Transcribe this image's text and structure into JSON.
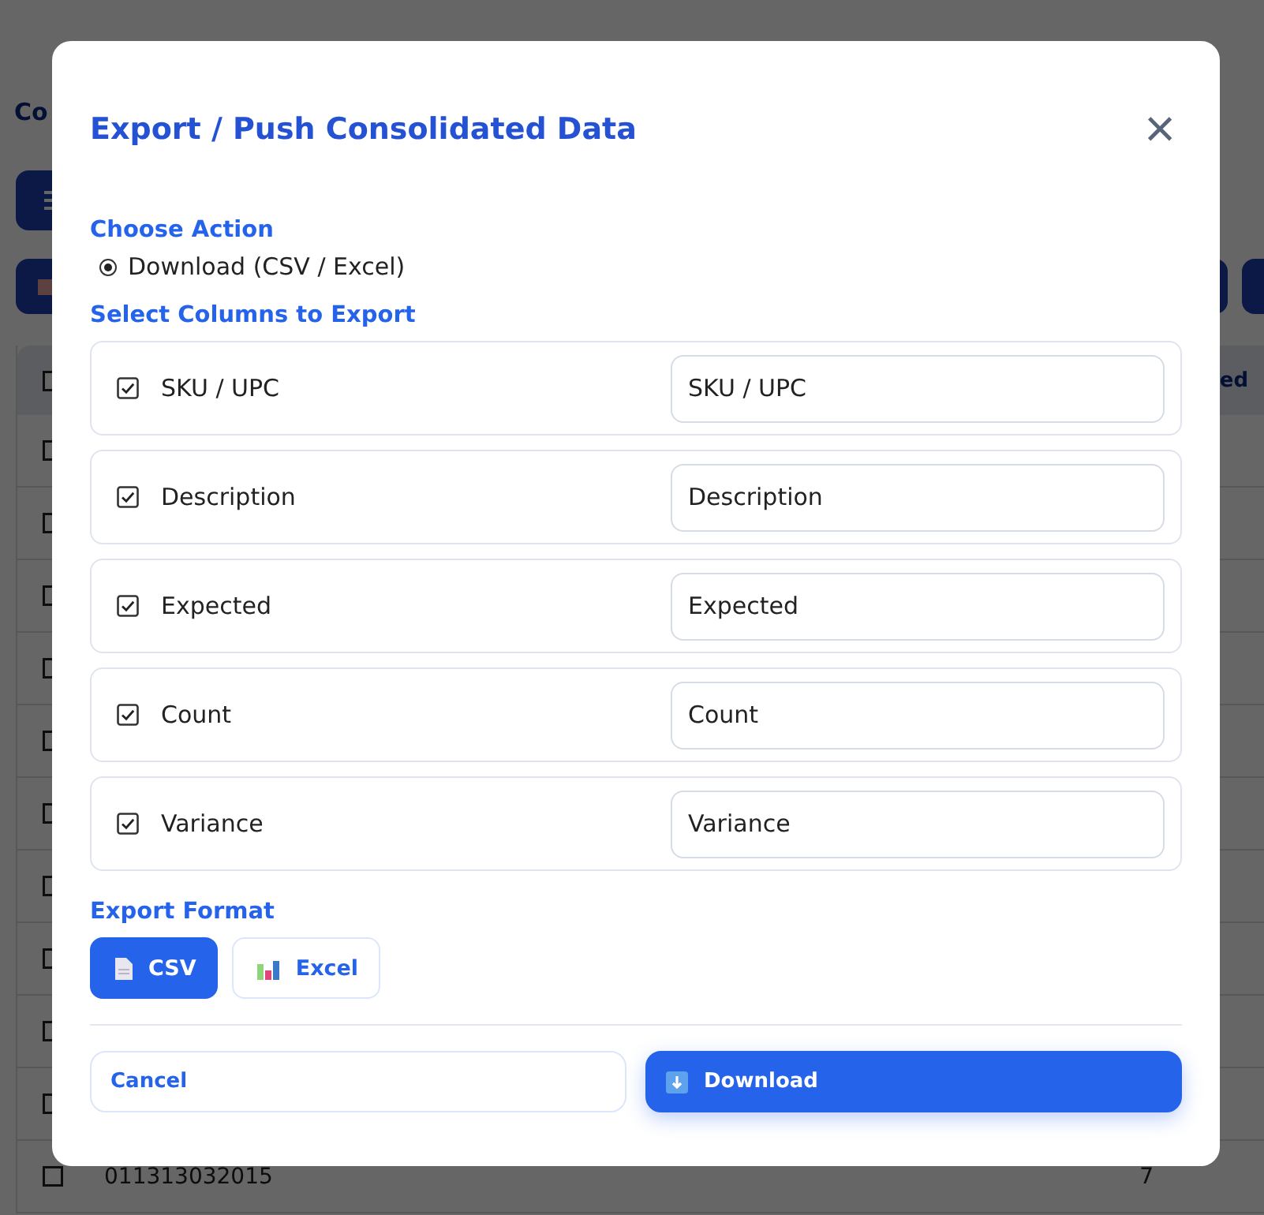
{
  "page": {
    "title": "Co",
    "table": {
      "header": {
        "checked": false,
        "last_column": "ed"
      },
      "rows": [
        {
          "checked": false
        },
        {
          "checked": false
        },
        {
          "checked": false
        },
        {
          "checked": false
        },
        {
          "checked": false
        },
        {
          "checked": false
        },
        {
          "checked": false
        },
        {
          "checked": false
        },
        {
          "checked": false
        },
        {
          "checked": false
        },
        {
          "checked": false,
          "cells": [
            "011313032015",
            "7"
          ]
        }
      ]
    }
  },
  "dialog": {
    "title": "Export / Push Consolidated Data",
    "close": "×",
    "action": {
      "label": "Choose Action",
      "options": [
        {
          "label": "Download (CSV / Excel)",
          "selected": true
        }
      ]
    },
    "columns": {
      "label": "Select Columns to Export",
      "items": [
        {
          "label": "SKU / UPC",
          "checked": true,
          "value": "SKU / UPC"
        },
        {
          "label": "Description",
          "checked": true,
          "value": "Description"
        },
        {
          "label": "Expected",
          "checked": true,
          "value": "Expected"
        },
        {
          "label": "Count",
          "checked": true,
          "value": "Count"
        },
        {
          "label": "Variance",
          "checked": true,
          "value": "Variance"
        }
      ]
    },
    "format": {
      "label": "Export Format",
      "options": [
        {
          "label": "CSV",
          "selected": true,
          "kind": "document"
        },
        {
          "label": "Excel",
          "selected": false,
          "kind": "chart"
        }
      ]
    },
    "buttons": [
      {
        "label": "Cancel",
        "kind": "secondary"
      },
      {
        "label": "Download",
        "kind": "primary"
      }
    ]
  }
}
